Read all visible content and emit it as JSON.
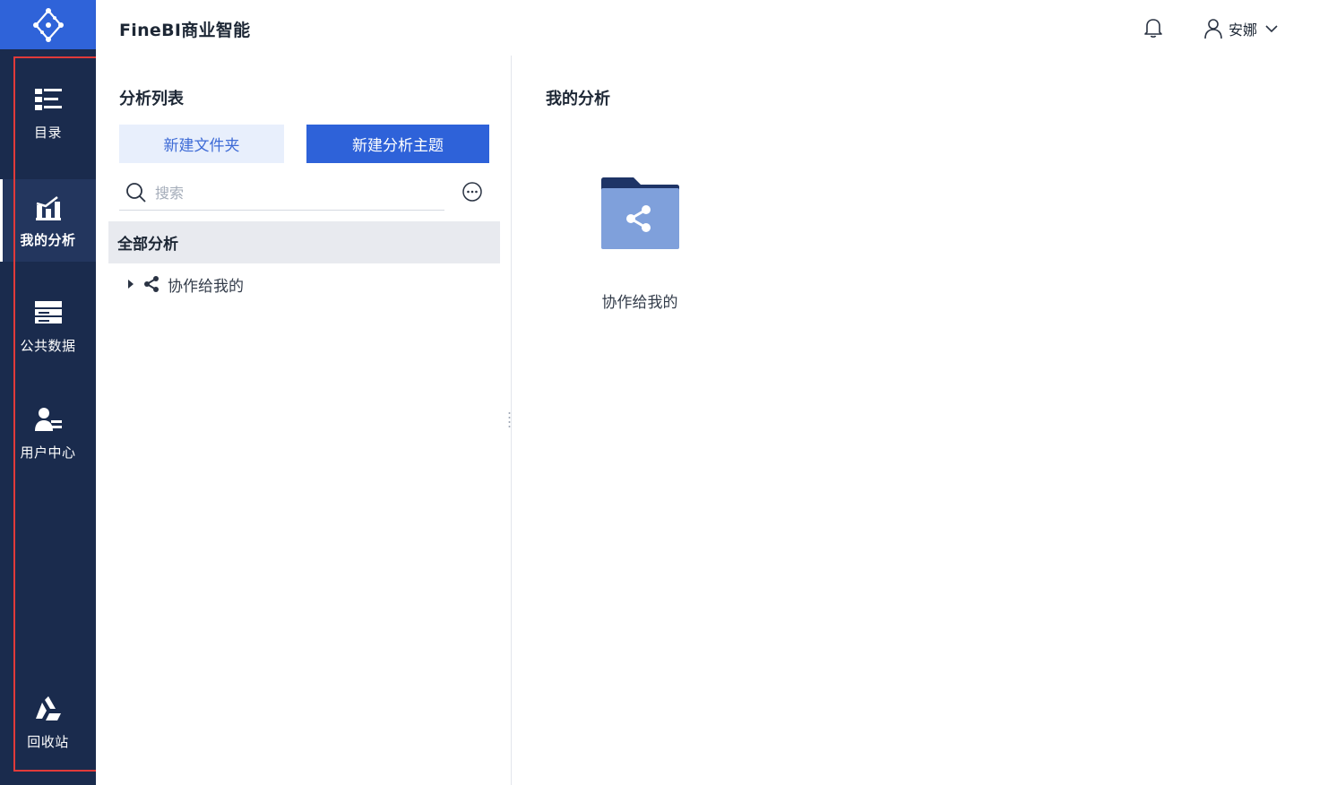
{
  "header": {
    "title": "FineBI商业智能",
    "user_name": "安娜"
  },
  "sidebar": {
    "items": [
      {
        "label": "目录",
        "icon": "catalog-icon"
      },
      {
        "label": "我的分析",
        "icon": "analysis-chart-icon",
        "active": true
      },
      {
        "label": "公共数据",
        "icon": "public-data-icon"
      },
      {
        "label": "用户中心",
        "icon": "user-center-icon"
      },
      {
        "label": "回收站",
        "icon": "recycle-bin-icon"
      }
    ]
  },
  "analysis_list": {
    "title": "分析列表",
    "new_folder_label": "新建文件夹",
    "new_theme_label": "新建分析主题",
    "search_placeholder": "搜索",
    "tree": {
      "root_label": "全部分析",
      "children": [
        {
          "label": "协作给我的",
          "icon": "share-icon"
        }
      ]
    }
  },
  "content": {
    "title": "我的分析",
    "folders": [
      {
        "label": "协作给我的",
        "icon": "shared-folder-icon"
      }
    ]
  },
  "colors": {
    "sidebar_bg": "#1a2b4d",
    "logo_bg": "#2f63d9",
    "primary": "#2e62d9",
    "folder": "#7fa0db",
    "highlight_border": "#e03a3a"
  }
}
